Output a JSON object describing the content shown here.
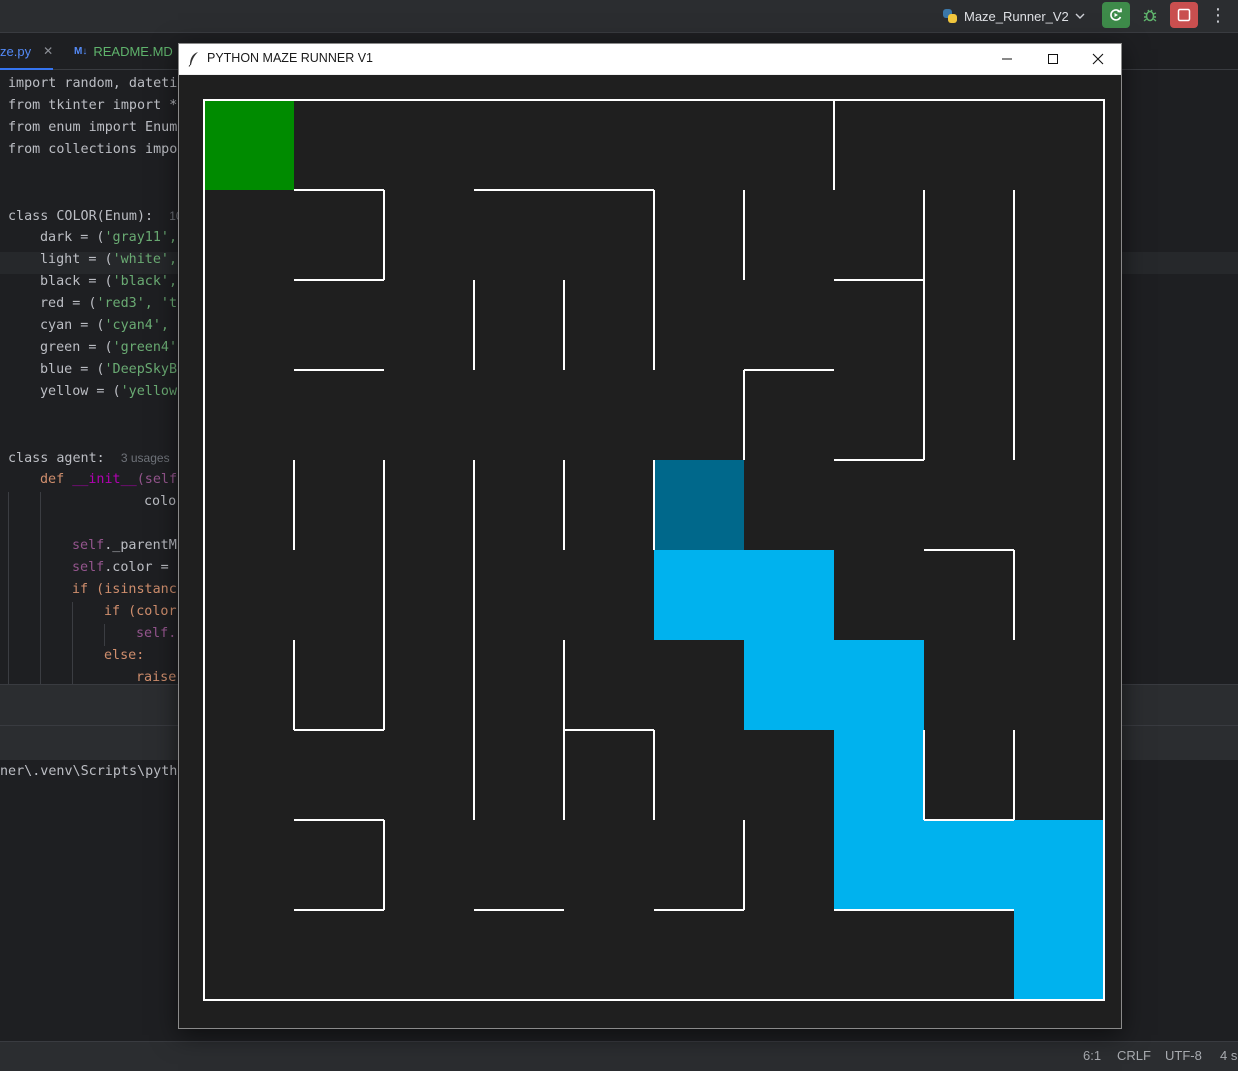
{
  "ide": {
    "run_config": "Maze_Runner_V2",
    "tabs": [
      {
        "label": "ze.py",
        "active": true
      },
      {
        "label": "README.MD",
        "badge": "M↓",
        "active": false
      }
    ],
    "console_line": "ner\\.venv\\Scripts\\pytho",
    "status": {
      "position": "6:1",
      "line_sep": "CRLF",
      "encoding": "UTF-8",
      "indent": "4 s"
    },
    "icons": [
      "python-icon",
      "chevron-down-icon",
      "rerun-icon",
      "debug-icon",
      "stop-icon",
      "more-icon",
      "close-icon"
    ]
  },
  "code": {
    "l1": "import random, dateti",
    "l2": "from tkinter import *",
    "l3": "from enum import Enum",
    "l4": "from collections impo",
    "l5a": "class COLOR(Enum):",
    "l5_hint": "10",
    "l6a": "dark = (",
    "l6s": "'gray11',",
    "l7a": "light = (",
    "l7s": "'white',",
    "l8a": "black = (",
    "l8s": "'black',",
    "l9a": "red = (",
    "l9s": "'red3', 't",
    "l10a": "cyan = (",
    "l10s": "'cyan4',",
    "l11a": "green = (",
    "l11s": "'green4'",
    "l12a": "blue = (",
    "l12s": "'DeepSkyB",
    "l13a": "yellow = (",
    "l13s": "'yellow",
    "l14a": "class agent:",
    "l14_hint": "3 usages",
    "l15a": "def ",
    "l15b": "__init__",
    "l15c": "(self",
    "l16": "colo",
    "l17a": "self",
    "l17b": "._parentM",
    "l18a": "self",
    "l18b": ".color = ",
    "l19a": "if (isinstanc",
    "l20a": "if (color",
    "l21a": "self.",
    "l22a": "else:",
    "l23a": "raise"
  },
  "maze_window": {
    "title": "PYTHON MAZE RUNNER V1",
    "icons": [
      "feather-icon",
      "minimize-icon",
      "maximize-icon",
      "close-icon"
    ],
    "colors": {
      "background": "#1f1f1f",
      "wall": "#ffffff",
      "start": "#008b00",
      "agent": "#00688b",
      "path": "#00b2ee"
    },
    "grid": {
      "rows": 10,
      "cols": 10
    },
    "start_cell": [
      0,
      0
    ],
    "agent_cell": [
      4,
      5
    ],
    "path_cells": [
      [
        5,
        5
      ],
      [
        5,
        6
      ],
      [
        6,
        6
      ],
      [
        6,
        7
      ],
      [
        7,
        7
      ],
      [
        8,
        7
      ],
      [
        8,
        8
      ],
      [
        8,
        9
      ],
      [
        9,
        9
      ]
    ],
    "walls_h": [
      [
        1,
        1,
        1
      ],
      [
        1,
        3,
        4
      ],
      [
        2,
        1,
        1
      ],
      [
        2,
        7,
        7
      ],
      [
        3,
        1,
        1
      ],
      [
        3,
        6,
        6
      ],
      [
        4,
        7,
        7
      ],
      [
        5,
        8,
        8
      ],
      [
        7,
        1,
        1
      ],
      [
        7,
        4,
        4
      ],
      [
        8,
        1,
        1
      ],
      [
        8,
        8,
        8
      ],
      [
        9,
        1,
        1
      ],
      [
        9,
        3,
        3
      ],
      [
        9,
        5,
        5
      ],
      [
        9,
        7,
        8
      ]
    ],
    "walls_v": [
      [
        7,
        0,
        0
      ],
      [
        2,
        1,
        1
      ],
      [
        5,
        1,
        2
      ],
      [
        6,
        1,
        1
      ],
      [
        8,
        1,
        3
      ],
      [
        9,
        1,
        2
      ],
      [
        3,
        2,
        2
      ],
      [
        4,
        2,
        2
      ],
      [
        6,
        3,
        3
      ],
      [
        9,
        3,
        3
      ],
      [
        1,
        4,
        4
      ],
      [
        2,
        4,
        6
      ],
      [
        3,
        4,
        6
      ],
      [
        4,
        4,
        4
      ],
      [
        5,
        4,
        4
      ],
      [
        9,
        5,
        5
      ],
      [
        1,
        6,
        6
      ],
      [
        4,
        6,
        6
      ],
      [
        3,
        7,
        7
      ],
      [
        4,
        7,
        7
      ],
      [
        5,
        7,
        7
      ],
      [
        8,
        7,
        7
      ],
      [
        9,
        7,
        7
      ],
      [
        2,
        8,
        8
      ],
      [
        6,
        8,
        8
      ]
    ]
  }
}
